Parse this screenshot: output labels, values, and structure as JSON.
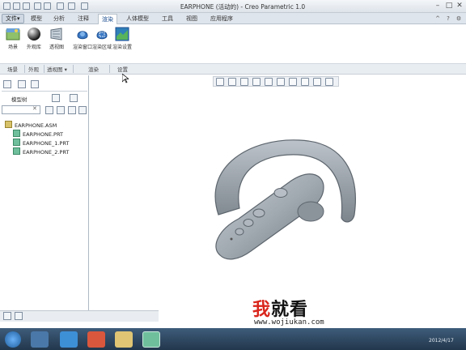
{
  "window": {
    "title": "EARPHONE (活动的) - Creo Parametric 1.0",
    "minimize": "–",
    "maximize": "□",
    "close": "✕"
  },
  "menu": {
    "file": "文件▾",
    "tabs": [
      "模型",
      "分析",
      "注释",
      "渲染",
      "人体模型",
      "工具",
      "视图",
      "应用程序"
    ],
    "active_tab": "渲染",
    "right_icons": [
      "^",
      "?",
      "⚙"
    ]
  },
  "ribbon": {
    "buttons": [
      {
        "label": "场景",
        "icon": "scene-icon"
      },
      {
        "label": "外观库",
        "icon": "appearance-sphere-icon"
      },
      {
        "label": "透视图",
        "icon": "perspective-icon"
      },
      {
        "label": "渲染窗口",
        "icon": "render-window-icon"
      },
      {
        "label": "渲染区域",
        "icon": "render-region-icon"
      },
      {
        "label": "渲染设置",
        "icon": "render-settings-icon"
      }
    ],
    "groups": [
      "场景",
      "外观",
      "透视图 ▾",
      "渲染",
      "设置"
    ]
  },
  "model_tree": {
    "title": "模型树",
    "items": [
      {
        "name": "EARPHONE.ASM",
        "type": "asm"
      },
      {
        "name": "EARPHONE.PRT",
        "type": "part"
      },
      {
        "name": "EARPHONE_1.PRT",
        "type": "part"
      },
      {
        "name": "EARPHONE_2.PRT",
        "type": "part"
      }
    ]
  },
  "taskbar": {
    "clock": "2012/4/17"
  },
  "watermark": {
    "text_red": "我",
    "text_black": "就看",
    "url": "www.wojiukan.com"
  },
  "colors": {
    "accent": "#3b79c4",
    "watermark_red": "#d9261c",
    "model_gray": "#9aa3ab"
  }
}
